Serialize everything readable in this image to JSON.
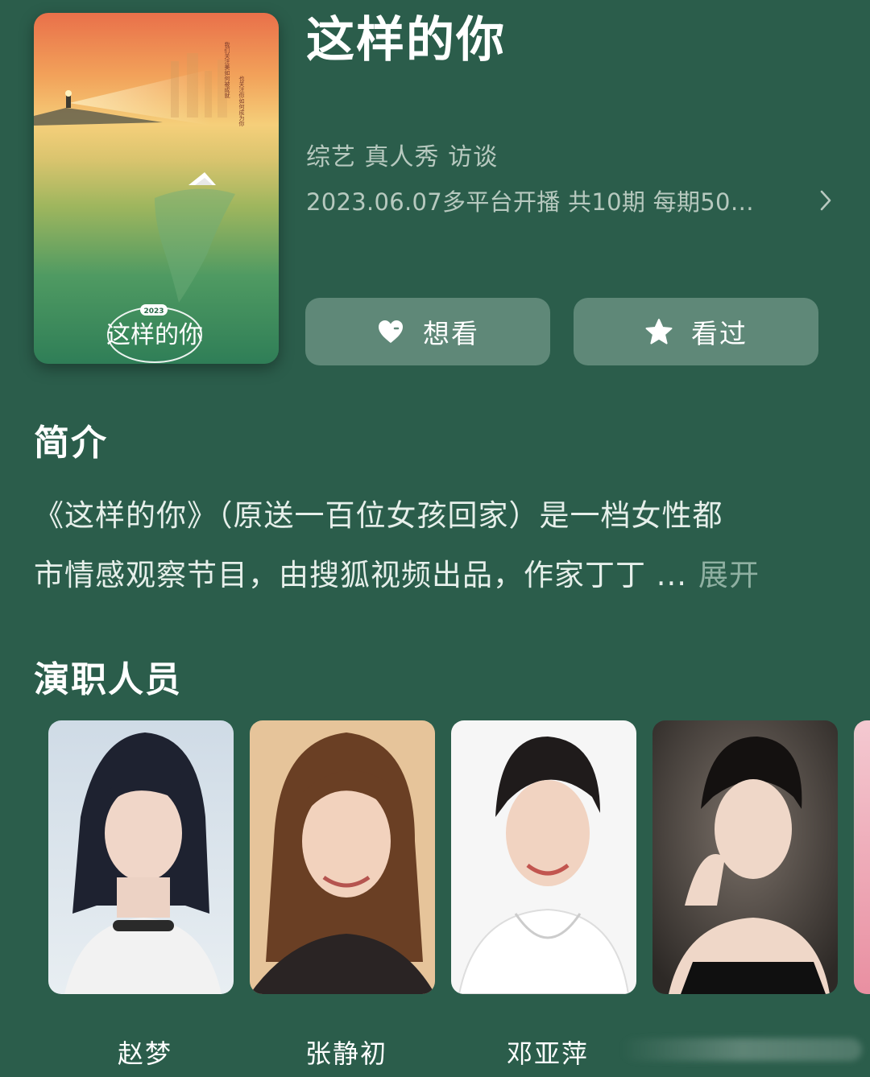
{
  "show": {
    "title": "这样的你",
    "genre": "综艺 真人秀 访谈",
    "release": "2023.06.07多平台开播 共10期 每期50…",
    "poster": {
      "year_badge": "2023",
      "logo_text": "这样的你",
      "tagline_1": "我们关注 “美” 如何被成就",
      "tagline_2": "也关注 “你” 如何成为你"
    }
  },
  "actions": {
    "want_label": "想看",
    "seen_label": "看过"
  },
  "intro": {
    "heading": "简介",
    "line1": "《这样的你》（原送一百位女孩回家）是一档女性都",
    "line2": "市情感观察节目，由搜狐视频出品，作家丁丁 ...",
    "expand_label": "展开"
  },
  "cast": {
    "heading": "演职人员",
    "members": [
      {
        "name": "赵梦"
      },
      {
        "name": "张静初"
      },
      {
        "name": "邓亚萍"
      },
      {
        "name": ""
      }
    ]
  },
  "colors": {
    "background": "#2b5d4b",
    "button_bg": "#5f8878",
    "secondary_text": "#b7c9bf",
    "expand_text": "#8fb0a2"
  }
}
